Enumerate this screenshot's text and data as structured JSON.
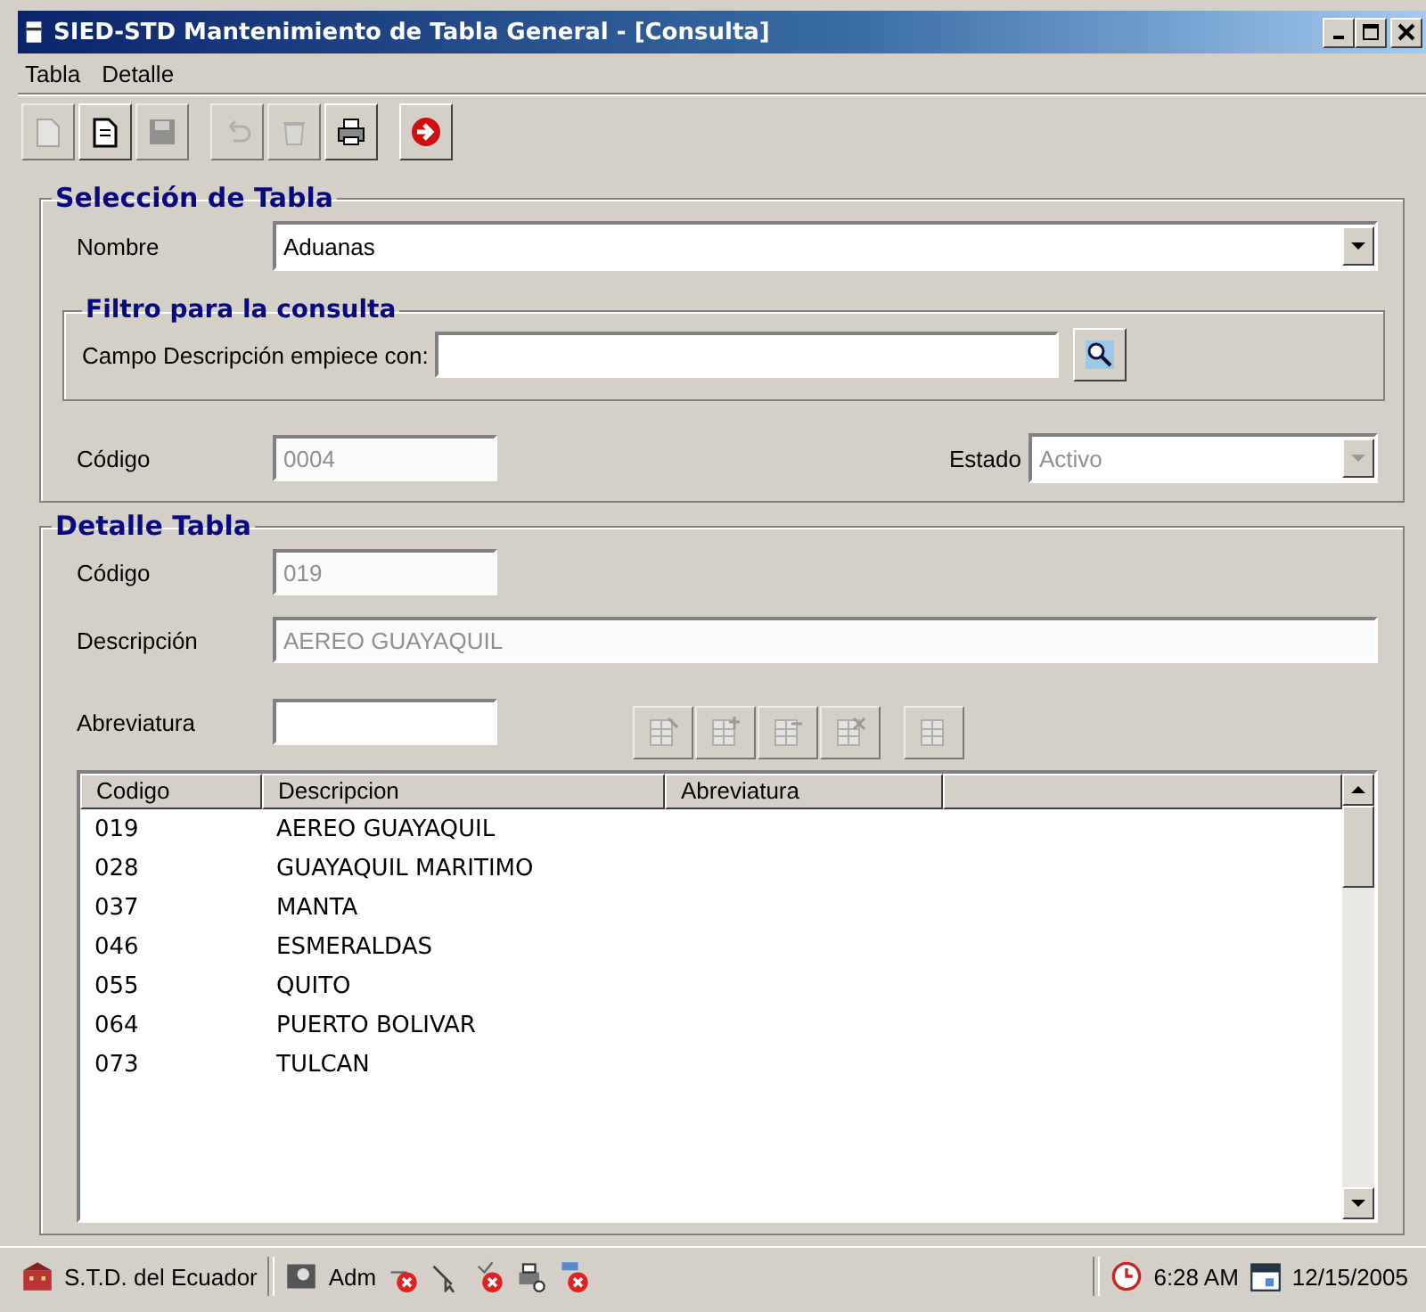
{
  "window": {
    "title": "SIED-STD Mantenimiento de Tabla General -  [Consulta]"
  },
  "menu": [
    {
      "label": "Tabla"
    },
    {
      "label": "Detalle"
    }
  ],
  "toolbar": [
    {
      "kind": "new",
      "disabled": true
    },
    {
      "kind": "edit",
      "disabled": false
    },
    {
      "kind": "save",
      "disabled": true
    },
    {
      "kind": "undo",
      "disabled": true
    },
    {
      "kind": "delete",
      "disabled": true
    },
    {
      "kind": "print",
      "disabled": false
    },
    {
      "kind": "exit",
      "disabled": false
    }
  ],
  "seleccion": {
    "title": "Selección de Tabla",
    "nombre_label": "Nombre",
    "nombre_value": "Aduanas",
    "filtro": {
      "title": "Filtro para la consulta",
      "label": "Campo Descripción empiece con:"
    },
    "codigo_label": "Código",
    "codigo_value": "0004",
    "estado_label": "Estado",
    "estado_value": "Activo",
    "disabled": true
  },
  "detalle": {
    "title": "Detalle Tabla",
    "codigo_label": "Código",
    "codigo_value": "019",
    "descripcion_label": "Descripción",
    "descripcion_value": "AEREO GUAYAQUIL",
    "abreviatura_label": "Abreviatura",
    "disabled": true,
    "buttons": [
      {
        "kind": "add",
        "disabled": true
      },
      {
        "kind": "insert",
        "disabled": true
      },
      {
        "kind": "edit",
        "disabled": true
      },
      {
        "kind": "delete",
        "disabled": true
      },
      {
        "kind": "copy",
        "disabled": true
      }
    ]
  },
  "table": {
    "columns": [
      "Codigo",
      "Descripcion",
      "Abreviatura"
    ],
    "rows": [
      {
        "codigo": "019",
        "descripcion": "AEREO GUAYAQUIL"
      },
      {
        "codigo": "028",
        "descripcion": "GUAYAQUIL MARITIMO"
      },
      {
        "codigo": "037",
        "descripcion": "MANTA"
      },
      {
        "codigo": "046",
        "descripcion": "ESMERALDAS"
      },
      {
        "codigo": "055",
        "descripcion": "QUITO"
      },
      {
        "codigo": "064",
        "descripcion": "PUERTO BOLIVAR"
      },
      {
        "codigo": "073",
        "descripcion": "TULCAN"
      }
    ]
  },
  "status_bar": {
    "company": "S.T.D. del Ecuador",
    "user": "Adm",
    "time": "6:28 AM",
    "date": "12/15/2005"
  }
}
